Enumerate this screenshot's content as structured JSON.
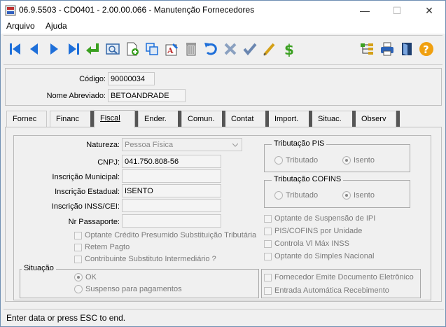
{
  "window": {
    "title": "06.9.5503 - CD0401 - 2.00.00.066 - Manutenção Fornecedores",
    "minimize": "—",
    "maximize": "☐",
    "close": "✕"
  },
  "menu": {
    "file": "Arquivo",
    "help": "Ajuda"
  },
  "toolbar": {
    "icons": [
      "first-icon",
      "previous-icon",
      "next-icon",
      "last-icon",
      "goto-icon",
      "search-icon",
      "add-icon",
      "copy-icon",
      "edit-icon",
      "delete-icon",
      "undo-icon",
      "cancel-icon",
      "save-icon",
      "clear-icon",
      "financial-icon",
      "tree-icon",
      "print-icon",
      "exit-icon",
      "help-icon"
    ]
  },
  "header": {
    "code_label": "Código:",
    "code_value": "90000034",
    "short_name_label": "Nome Abreviado:",
    "short_name_value": "BETOANDRADE"
  },
  "tabs": [
    {
      "label": "Fornec"
    },
    {
      "label": "Financ"
    },
    {
      "label": "Fiscal",
      "active": true
    },
    {
      "label": "Ender."
    },
    {
      "label": "Comun."
    },
    {
      "label": "Contat"
    },
    {
      "label": "Import."
    },
    {
      "label": "Situac."
    },
    {
      "label": "Observ"
    }
  ],
  "fiscal": {
    "natureza_label": "Natureza:",
    "natureza_value": "Pessoa Física",
    "cnpj_label": "CNPJ:",
    "cnpj_value": "041.750.808-56",
    "ins_municipal_label": "Inscrição Municipal:",
    "ins_municipal_value": "",
    "ins_estadual_label": "Inscrição Estadual:",
    "ins_estadual_value": "ISENTO",
    "ins_inss_label": "Inscrição INSS/CEI:",
    "ins_inss_value": "",
    "passaporte_label": "Nr Passaporte:",
    "passaporte_value": "",
    "chk_credito": "Optante Crédito Presumido Substituição Tributária",
    "chk_retem": "Retem Pagto",
    "chk_contribuinte": "Contribuinte Substituto Intermediário ?",
    "pis_title": "Tributação PIS",
    "pis_tributado": "Tributado",
    "pis_isento": "Isento",
    "cofins_title": "Tributação COFINS",
    "cofins_tributado": "Tributado",
    "cofins_isento": "Isento",
    "chk_ipi": "Optante de Suspensão de IPI",
    "chk_pis_cofins": "PIS/COFINS por Unidade",
    "chk_vl_max": "Controla Vl Máx INSS",
    "chk_simples": "Optante do Simples Nacional",
    "situacao_title": "Situação",
    "situacao_ok": "OK",
    "situacao_suspenso": "Suspenso para pagamentos",
    "chk_doc_eletronico": "Fornecedor Emite Documento Eletrônico",
    "chk_entrada_auto": "Entrada Automática Recebimento"
  },
  "status": {
    "text": "Enter data or press ESC to end."
  },
  "colors": {
    "accent_blue": "#1e6fd9",
    "green": "#3aa020",
    "window_border": "#6f8fb3"
  }
}
